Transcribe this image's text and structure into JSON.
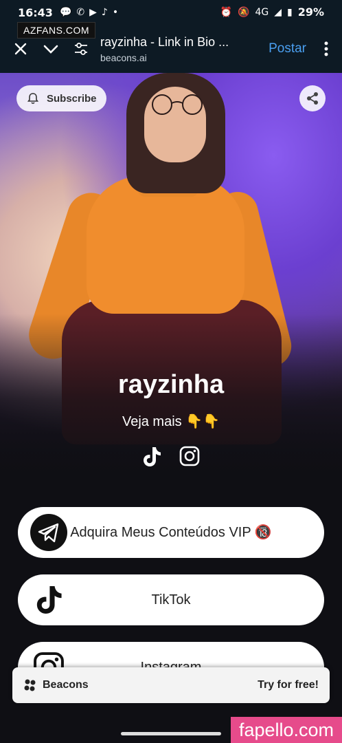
{
  "status_bar": {
    "time": "16:43",
    "battery": "29%",
    "network": "4G"
  },
  "browser": {
    "title": "rayzinha - Link in Bio ...",
    "url": "beacons.ai",
    "post_label": "Postar"
  },
  "watermarks": {
    "top": "AZFANS.COM",
    "bottom": "fapello.com"
  },
  "hero": {
    "subscribe_label": "Subscribe",
    "name": "rayzinha",
    "tagline": "Veja mais 👇👇"
  },
  "links": [
    {
      "label": "Adquira Meus Conteúdos VIP 🔞",
      "icon": "telegram-icon"
    },
    {
      "label": "TikTok",
      "icon": "tiktok-icon"
    },
    {
      "label": "Instagram",
      "icon": "instagram-icon"
    }
  ],
  "footer": {
    "brand": "Beacons",
    "cta": "Try for free!"
  },
  "colors": {
    "browser_bg": "#0d1a24",
    "accent_link": "#4a9ff0",
    "page_bg": "#0f0f14",
    "watermark_pink": "#e64b8b"
  }
}
